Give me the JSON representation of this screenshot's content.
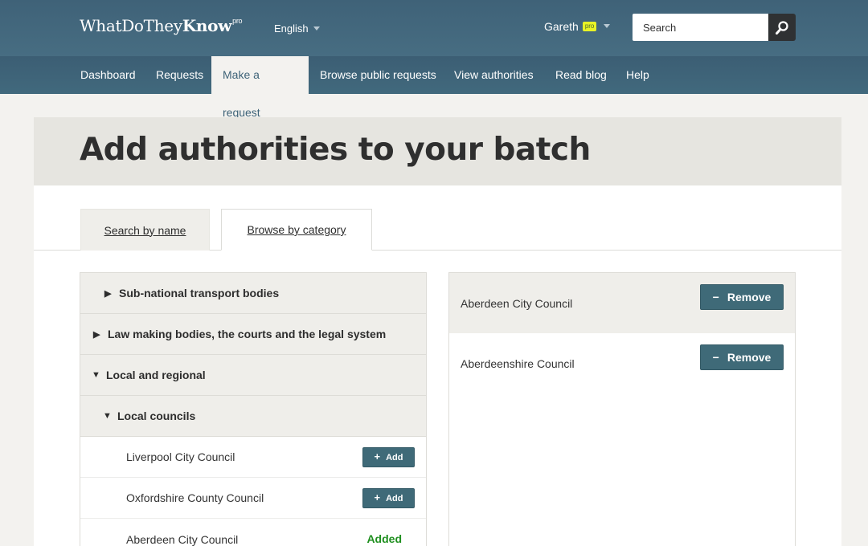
{
  "header": {
    "logo_light": "WhatDoThey",
    "logo_bold": "Know",
    "logo_sup": "pro",
    "language": "English",
    "user_name": "Gareth",
    "user_badge": "pro",
    "search_placeholder": "Search"
  },
  "nav": {
    "items": [
      {
        "label": "Dashboard"
      },
      {
        "label": "Requests"
      },
      {
        "label": "Make a request",
        "active": true
      },
      {
        "label": "Browse public requests"
      },
      {
        "label": "View authorities"
      },
      {
        "label": "Read blog"
      },
      {
        "label": "Help"
      }
    ]
  },
  "page": {
    "title": "Add authorities to your batch"
  },
  "tabs": {
    "search_by_name": "Search by name",
    "browse_by_category": "Browse by category",
    "active": "browse_by_category"
  },
  "categories": {
    "rows": [
      {
        "label": "Sub-national transport bodies",
        "expanded": false,
        "level": 1
      },
      {
        "label": "Law making bodies, the courts and the legal system",
        "expanded": false,
        "level": 0
      },
      {
        "label": "Local and regional",
        "expanded": true,
        "level": 0
      },
      {
        "label": "Local councils",
        "expanded": true,
        "level": 1
      }
    ],
    "authorities": [
      {
        "name": "Liverpool City Council",
        "action": "Add",
        "state": "add"
      },
      {
        "name": "Oxfordshire County Council",
        "action": "Add",
        "state": "add"
      },
      {
        "name": "Aberdeen City Council",
        "action": "Added",
        "state": "added"
      }
    ]
  },
  "selected": {
    "remove_label": "Remove",
    "items": [
      {
        "name": "Aberdeen City Council"
      },
      {
        "name": "Aberdeenshire Council"
      }
    ]
  },
  "colors": {
    "header_bg": "#3f6278",
    "button": "#3f6a78",
    "added_text": "#1f8f1f",
    "pro_badge": "#e8f326"
  }
}
